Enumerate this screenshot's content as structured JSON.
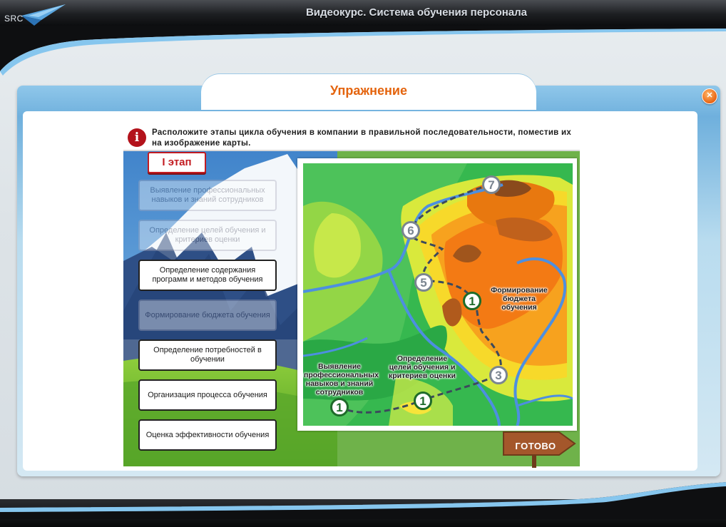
{
  "app": {
    "logo_text": "SRC",
    "title": "Видеокурс. Система обучения персонала"
  },
  "dialog": {
    "title": "Упражнение",
    "close_icon": "close-icon"
  },
  "exercise": {
    "instruction": "Расположите этапы цикла обучения в компании в правильной последовательности, поместив их на изображение карты.",
    "stage_badge": "I этап",
    "cards": [
      {
        "label": "Выявление профессиональных навыков и знаний сотрудников",
        "placed": true
      },
      {
        "label": "Определение целей обучения и критериев оценки",
        "placed": true
      },
      {
        "label": "Определение содержания программ и методов обучения",
        "placed": false
      },
      {
        "label": "Формирование бюджета обучения",
        "placed": true
      },
      {
        "label": "Определение потребностей в обучении",
        "placed": false
      },
      {
        "label": "Организация процесса обучения",
        "placed": false
      },
      {
        "label": "Оценка эффективности обучения",
        "placed": false
      }
    ],
    "map_labels": {
      "skills": "Выявление профессиональных навыков и знаний сотрудников",
      "goals": "Определение целей обучения и критериев оценки",
      "budget": "Формирование бюджета обучения"
    },
    "markers": [
      {
        "id": "m1a",
        "number": "1",
        "state": "done"
      },
      {
        "id": "m1b",
        "number": "1",
        "state": "done"
      },
      {
        "id": "m1c",
        "number": "1",
        "state": "done"
      },
      {
        "id": "m3",
        "number": "3",
        "state": "empty"
      },
      {
        "id": "m5",
        "number": "5",
        "state": "empty"
      },
      {
        "id": "m6",
        "number": "6",
        "state": "empty"
      },
      {
        "id": "m7",
        "number": "7",
        "state": "empty"
      }
    ],
    "done_button": "ГОТОВО"
  },
  "colors": {
    "accent_orange": "#e4640e",
    "stage_red": "#c21c22",
    "done_green": "#1f6b2a",
    "sign_brown": "#a4572b"
  }
}
